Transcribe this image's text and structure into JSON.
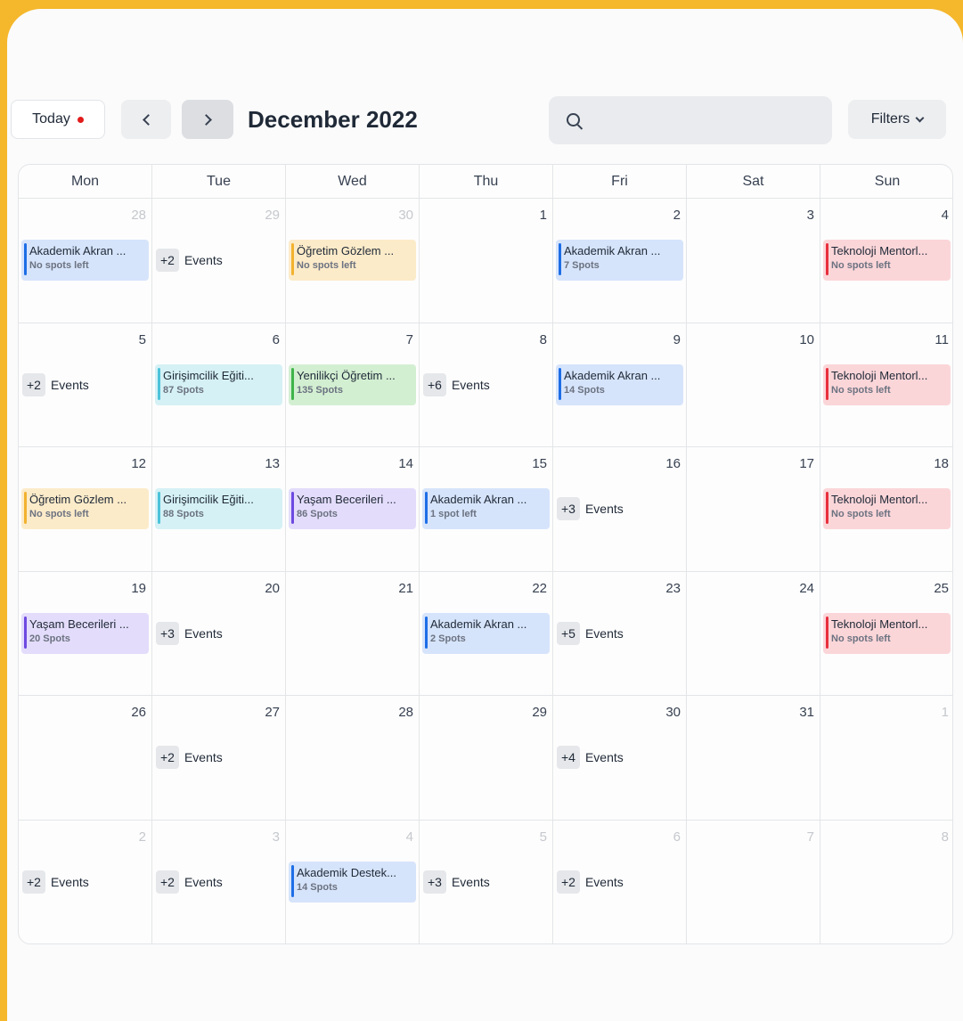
{
  "toolbar": {
    "today_label": "Today",
    "month_title": "December 2022",
    "search_placeholder": "",
    "filters_label": "Filters"
  },
  "colors": {
    "background": "#f5b72c",
    "today_dot": "#e21b1b",
    "blue_bg": "#d6e4fb",
    "blue_bar": "#1e6ee6",
    "orange_bg": "#fcebc9",
    "orange_bar": "#f2b230",
    "cyan_bg": "#d5f1f5",
    "cyan_bar": "#4cc3d9",
    "green_bg": "#d3efd2",
    "green_bar": "#3fb44a",
    "purple_bg": "#e3dcfb",
    "purple_bar": "#6d49e0",
    "red_bg": "#fbd6d9",
    "red_bar": "#e8303e"
  },
  "weekdays": [
    "Mon",
    "Tue",
    "Wed",
    "Thu",
    "Fri",
    "Sat",
    "Sun"
  ],
  "more_suffix": "Events",
  "cells": [
    {
      "day": "28",
      "muted": true,
      "event": {
        "title": "Akademik Akran ...",
        "sub": "No spots left",
        "color": "blue"
      }
    },
    {
      "day": "29",
      "muted": true,
      "more": "+2"
    },
    {
      "day": "30",
      "muted": true,
      "event": {
        "title": "Öğretim Gözlem ...",
        "sub": "No spots left",
        "color": "orange"
      }
    },
    {
      "day": "1"
    },
    {
      "day": "2",
      "event": {
        "title": "Akademik Akran ...",
        "sub": "7 Spots",
        "color": "blue"
      }
    },
    {
      "day": "3"
    },
    {
      "day": "4",
      "event": {
        "title": "Teknoloji Mentorl...",
        "sub": "No spots left",
        "color": "red"
      }
    },
    {
      "day": "5",
      "more": "+2"
    },
    {
      "day": "6",
      "event": {
        "title": "Girişimcilik Eğiti...",
        "sub": "87 Spots",
        "color": "cyan"
      }
    },
    {
      "day": "7",
      "event": {
        "title": "Yenilikçi Öğretim ...",
        "sub": "135 Spots",
        "color": "green"
      }
    },
    {
      "day": "8",
      "more": "+6"
    },
    {
      "day": "9",
      "event": {
        "title": "Akademik Akran ...",
        "sub": "14 Spots",
        "color": "blue"
      }
    },
    {
      "day": "10"
    },
    {
      "day": "11",
      "event": {
        "title": "Teknoloji Mentorl...",
        "sub": "No spots left",
        "color": "red"
      }
    },
    {
      "day": "12",
      "event": {
        "title": "Öğretim Gözlem ...",
        "sub": "No spots left",
        "color": "orange"
      }
    },
    {
      "day": "13",
      "event": {
        "title": "Girişimcilik Eğiti...",
        "sub": "88 Spots",
        "color": "cyan"
      }
    },
    {
      "day": "14",
      "event": {
        "title": "Yaşam Becerileri ...",
        "sub": "86 Spots",
        "color": "purple"
      }
    },
    {
      "day": "15",
      "event": {
        "title": "Akademik Akran ...",
        "sub": "1 spot left",
        "color": "blue"
      }
    },
    {
      "day": "16",
      "more": "+3"
    },
    {
      "day": "17"
    },
    {
      "day": "18",
      "event": {
        "title": "Teknoloji Mentorl...",
        "sub": "No spots left",
        "color": "red"
      }
    },
    {
      "day": "19",
      "event": {
        "title": "Yaşam Becerileri ...",
        "sub": "20 Spots",
        "color": "purple"
      }
    },
    {
      "day": "20",
      "more": "+3"
    },
    {
      "day": "21"
    },
    {
      "day": "22",
      "event": {
        "title": "Akademik Akran ...",
        "sub": "2 Spots",
        "color": "blue"
      }
    },
    {
      "day": "23",
      "more": "+5"
    },
    {
      "day": "24"
    },
    {
      "day": "25",
      "event": {
        "title": "Teknoloji Mentorl...",
        "sub": "No spots left",
        "color": "red"
      }
    },
    {
      "day": "26"
    },
    {
      "day": "27",
      "more": "+2"
    },
    {
      "day": "28"
    },
    {
      "day": "29"
    },
    {
      "day": "30",
      "more": "+4"
    },
    {
      "day": "31"
    },
    {
      "day": "1",
      "muted": true
    },
    {
      "day": "2",
      "muted": true,
      "more": "+2"
    },
    {
      "day": "3",
      "muted": true,
      "more": "+2"
    },
    {
      "day": "4",
      "muted": true,
      "event": {
        "title": "Akademik Destek...",
        "sub": "14 Spots",
        "color": "blue"
      }
    },
    {
      "day": "5",
      "muted": true,
      "more": "+3"
    },
    {
      "day": "6",
      "muted": true,
      "more": "+2"
    },
    {
      "day": "7",
      "muted": true
    },
    {
      "day": "8",
      "muted": true
    }
  ]
}
